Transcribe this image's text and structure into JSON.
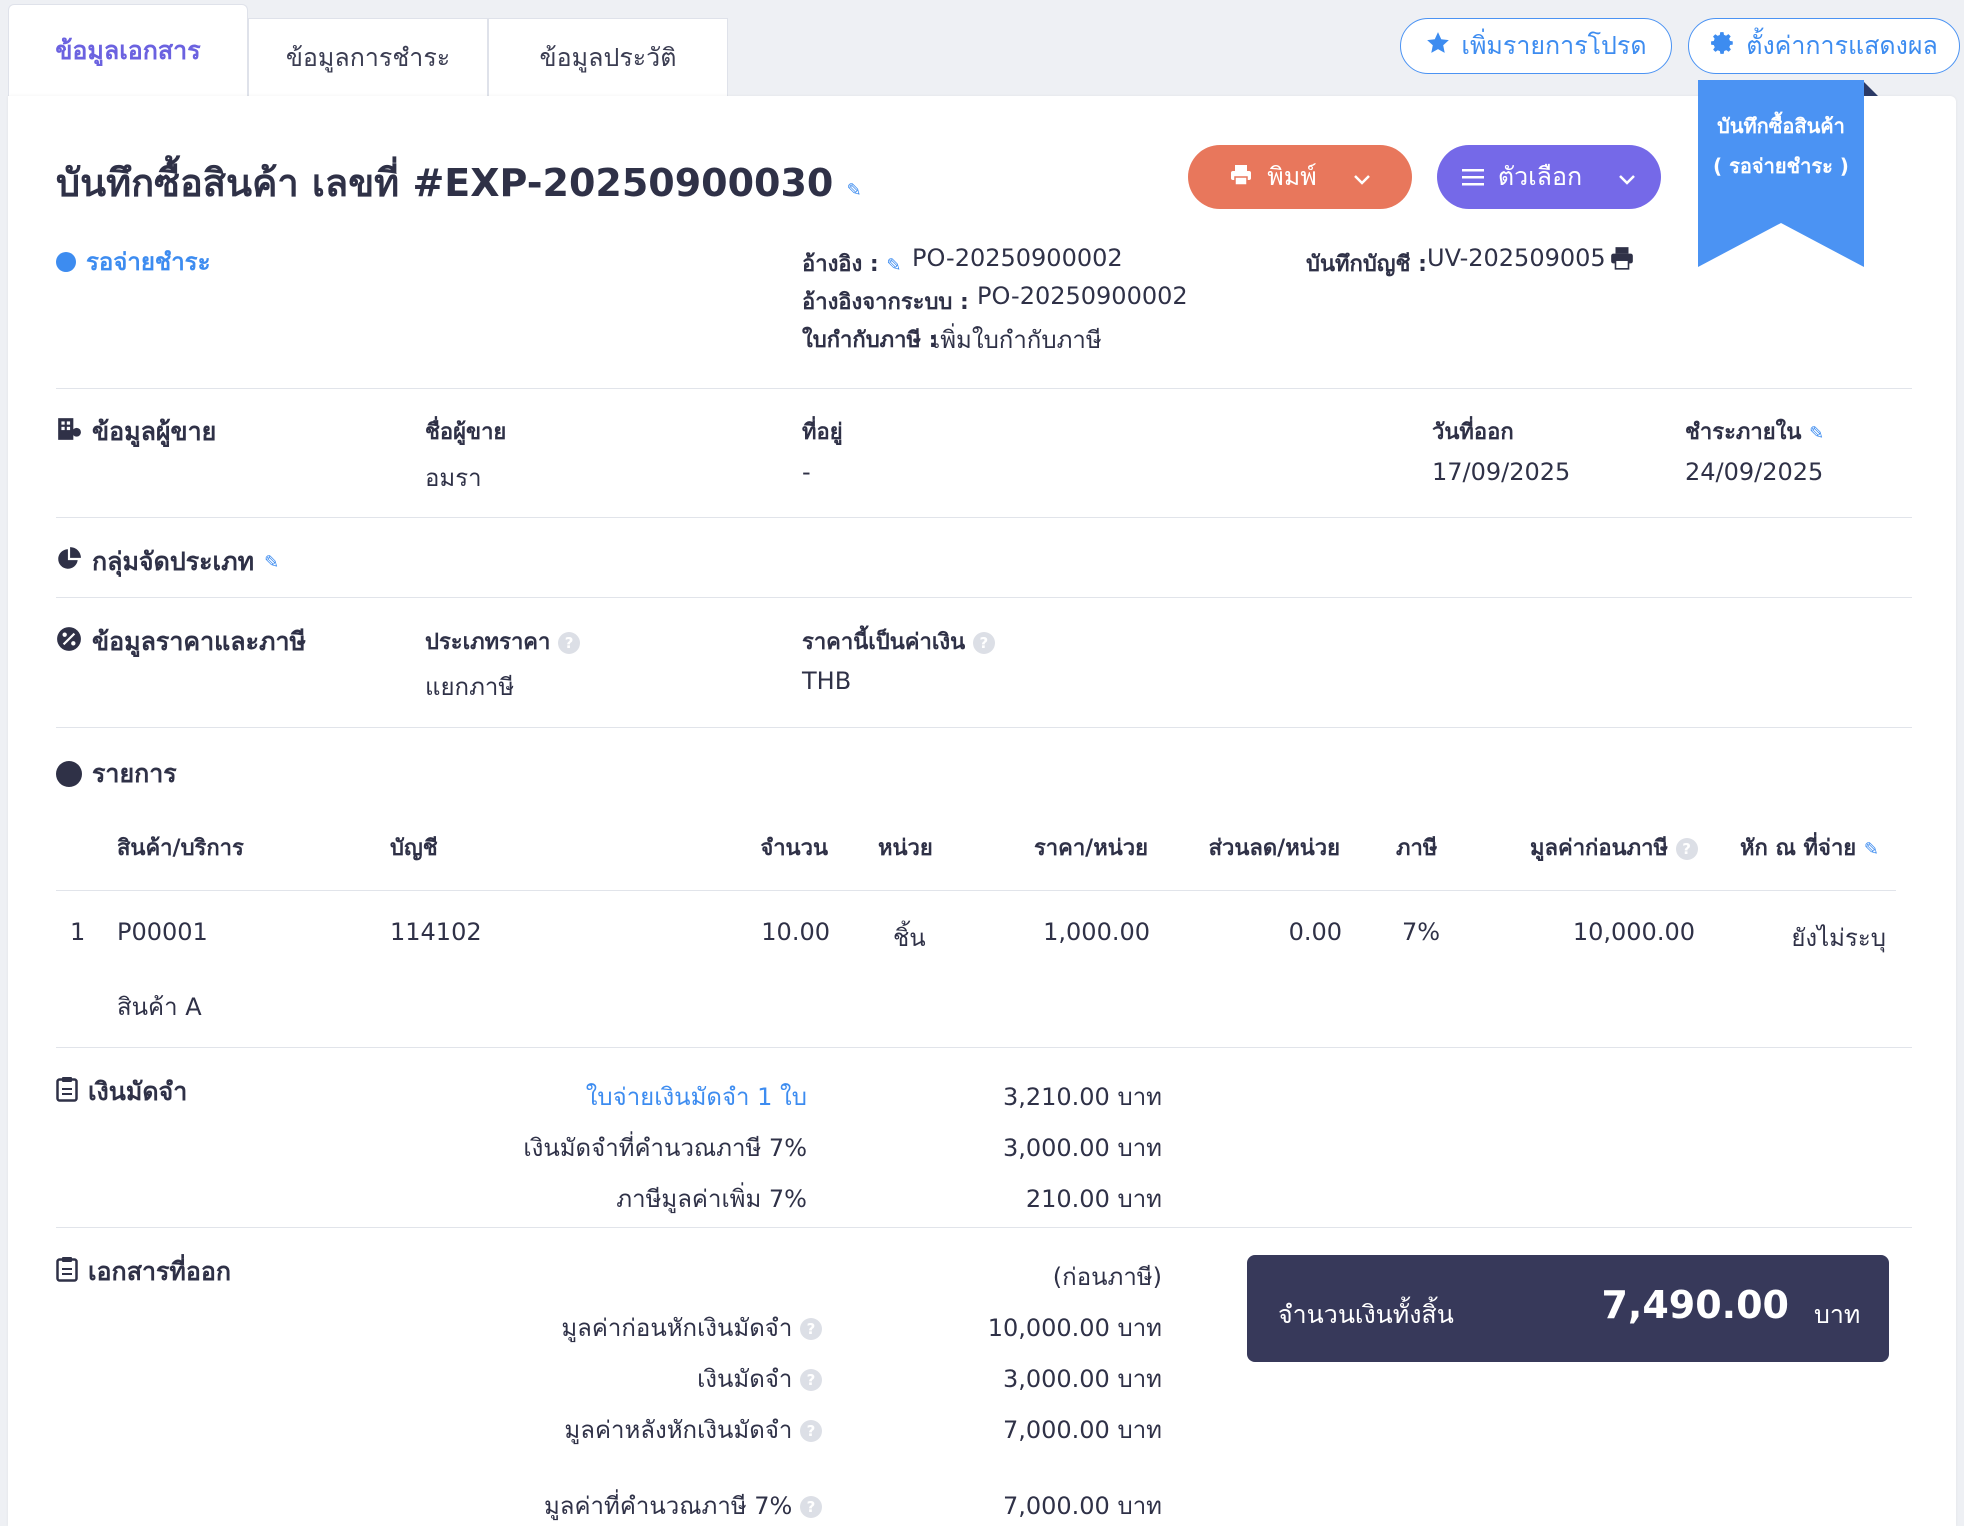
{
  "tabs": [
    {
      "label": "ข้อมูลเอกสาร"
    },
    {
      "label": "ข้อมูลการชำระ"
    },
    {
      "label": "ข้อมูลประวัติ"
    }
  ],
  "top_actions": {
    "favorite_label": "เพิ่มรายการโปรด",
    "display_settings_label": "ตั้งค่าการแสดงผล"
  },
  "ribbon": {
    "line1": "บันทึกซื้อสินค้า",
    "line2": "( รอจ่ายชำระ )"
  },
  "header": {
    "title": "บันทึกซื้อสินค้า เลขที่ #EXP-20250900030",
    "print_label": "พิมพ์",
    "options_label": "ตัวเลือก",
    "status": "รอจ่ายชำระ",
    "colors": {
      "print": "#e8775c",
      "options": "#7569e8",
      "status": "#3d8cf0"
    }
  },
  "refs": {
    "reference_label": "อ้างอิง :",
    "reference_value": "PO-20250900002",
    "system_ref_label": "อ้างอิงจากระบบ :",
    "system_ref_value": "PO-20250900002",
    "tax_invoice_label": "ใบกำกับภาษี :",
    "tax_invoice_link": "เพิ่มใบกำกับภาษี",
    "ledger_label": "บันทึกบัญชี :",
    "ledger_value": "UV-202509005"
  },
  "vendor": {
    "section_title": "ข้อมูลผู้ขาย",
    "name_label": "ชื่อผู้ขาย",
    "name_value": "อมรา",
    "address_label": "ที่อยู่",
    "address_value": "-",
    "issue_date_label": "วันที่ออก",
    "issue_date_value": "17/09/2025",
    "due_label": "ชำระภายใน",
    "due_value": "24/09/2025"
  },
  "classification": {
    "section_title": "กลุ่มจัดประเภท"
  },
  "pricing": {
    "section_title": "ข้อมูลราคาและภาษี",
    "price_type_label": "ประเภทราคา",
    "price_type_value": "แยกภาษี",
    "currency_label": "ราคานี้เป็นค่าเงิน",
    "currency_value": "THB"
  },
  "items": {
    "section_title": "รายการ",
    "columns": [
      "สินค้า/บริการ",
      "บัญชี",
      "จำนวน",
      "หน่วย",
      "ราคา/หน่วย",
      "ส่วนลด/หน่วย",
      "ภาษี",
      "มูลค่าก่อนภาษี",
      "หัก ณ ที่จ่าย"
    ],
    "rows": [
      {
        "no": "1",
        "code": "P00001",
        "desc": "สินค้า A",
        "account": "114102",
        "qty": "10.00",
        "unit": "ชิ้น",
        "price": "1,000.00",
        "discount": "0.00",
        "tax": "7%",
        "pretax": "10,000.00",
        "wht": "ยังไม่ระบุ"
      }
    ]
  },
  "deposit": {
    "section_title": "เงินมัดจำ",
    "rows": [
      {
        "label": "ใบจ่ายเงินมัดจำ 1 ใบ",
        "value": "3,210.00 บาท"
      },
      {
        "label": "เงินมัดจำที่คำนวณภาษี 7%",
        "value": "3,000.00 บาท"
      },
      {
        "label": "ภาษีมูลค่าเพิ่ม 7%",
        "value": "210.00 บาท"
      }
    ]
  },
  "issued": {
    "section_title": "เอกสารที่ออก",
    "pretax_note": "(ก่อนภาษี)",
    "rows": [
      {
        "label": "มูลค่าก่อนหักเงินมัดจำ",
        "value": "10,000.00 บาท"
      },
      {
        "label": "เงินมัดจำ",
        "value": "3,000.00 บาท"
      },
      {
        "label": "มูลค่าหลังหักเงินมัดจำ",
        "value": "7,000.00 บาท"
      },
      {
        "label": "มูลค่าที่คำนวณภาษี 7%",
        "value": "7,000.00 บาท"
      }
    ]
  },
  "total": {
    "label": "จำนวนเงินทั้งสิ้น",
    "amount": "7,490.00",
    "currency": "บาท"
  }
}
